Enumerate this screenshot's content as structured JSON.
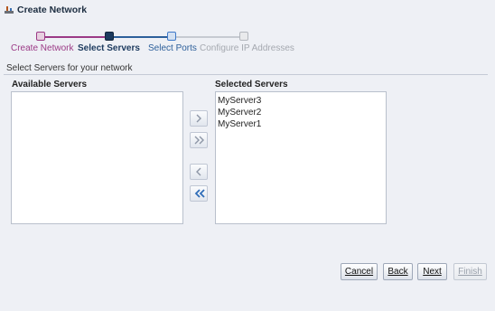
{
  "dialog": {
    "title": "Create Network"
  },
  "train": {
    "steps": [
      {
        "label": "Create Network",
        "state": "visited"
      },
      {
        "label": "Select Servers",
        "state": "current"
      },
      {
        "label": "Select Ports",
        "state": "next"
      },
      {
        "label": "Configure IP Addresses",
        "state": "disabled"
      }
    ]
  },
  "page": {
    "subtitle": "Select Servers for your network"
  },
  "available": {
    "header": "Available Servers",
    "items": []
  },
  "selected": {
    "header": "Selected Servers",
    "items": [
      "MyServer3",
      "MyServer2",
      "MyServer1"
    ]
  },
  "shuttle": {
    "icons": [
      "move-right-icon",
      "move-all-right-icon",
      "move-left-icon",
      "move-all-left-icon"
    ]
  },
  "buttons": {
    "cancel": "Cancel",
    "back": "Back",
    "next": "Next",
    "finish": "Finish"
  },
  "colors": {
    "visited": "#9b3a86",
    "current": "#1c3a5e",
    "next": "#2d5f9a",
    "disabled": "#a5a9b0",
    "accent": "#3f79c8"
  }
}
